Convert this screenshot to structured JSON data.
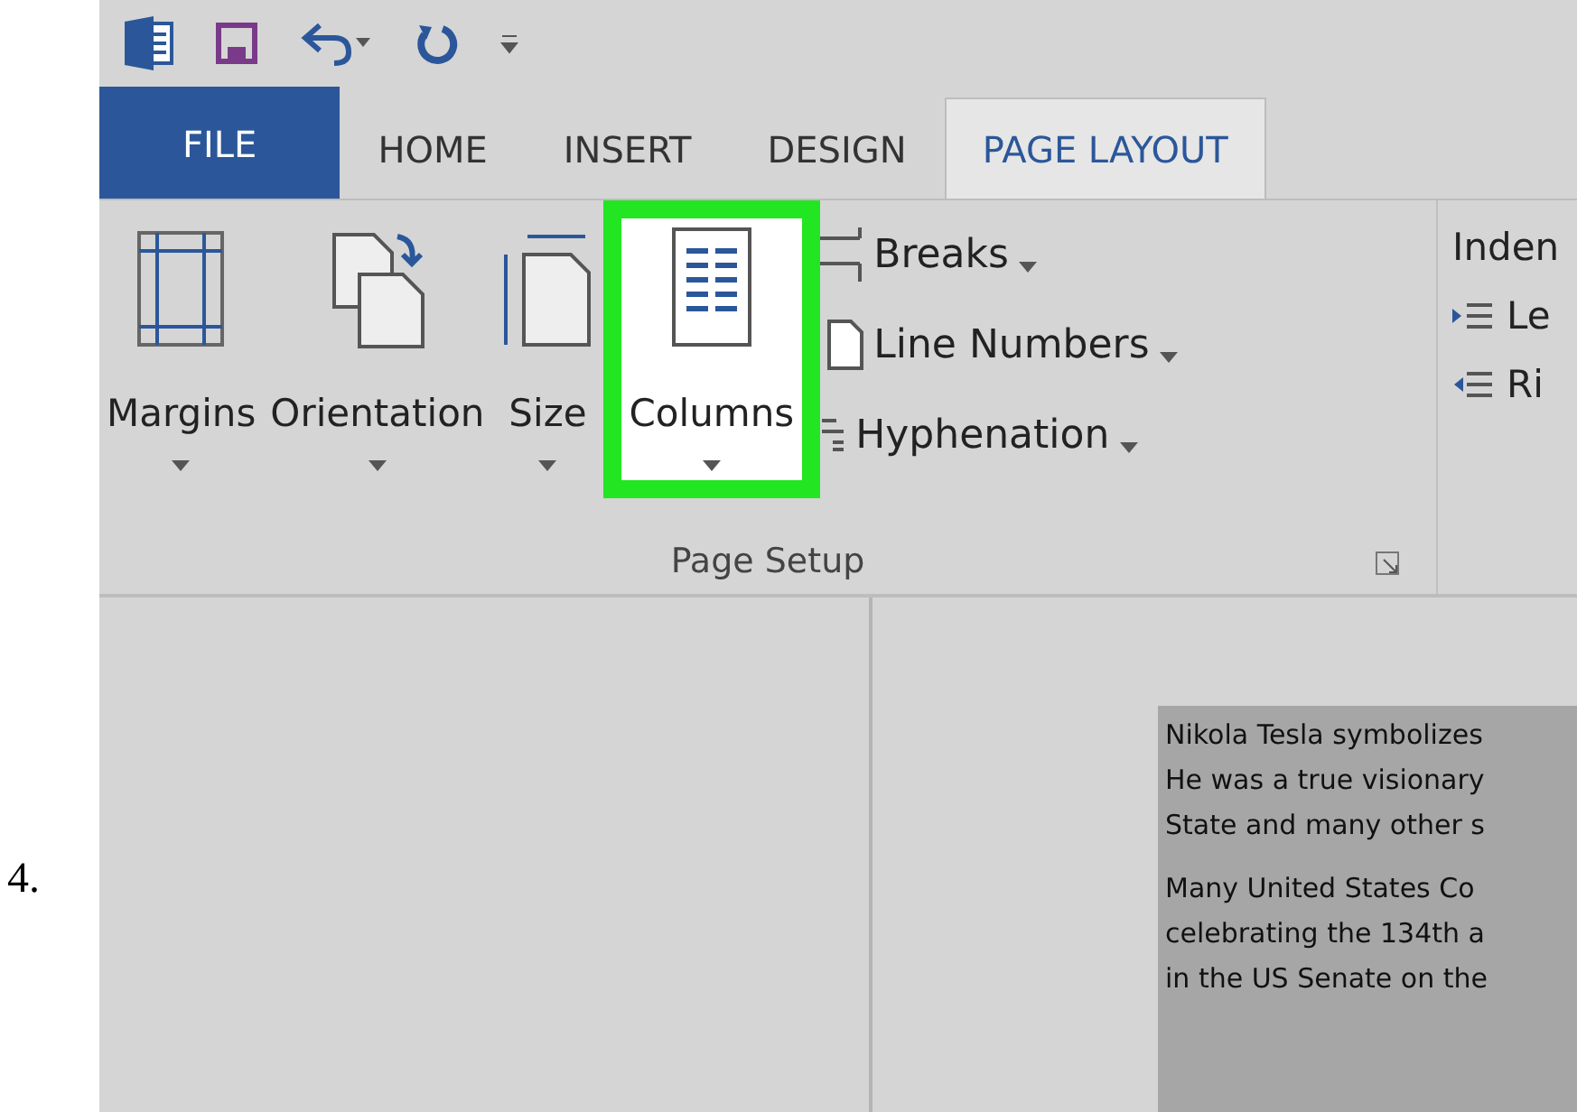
{
  "step_number": "4.",
  "tabs": [
    {
      "label": "FILE",
      "kind": "file",
      "selected": false
    },
    {
      "label": "HOME",
      "kind": "tab",
      "selected": false
    },
    {
      "label": "INSERT",
      "kind": "tab",
      "selected": false
    },
    {
      "label": "DESIGN",
      "kind": "tab",
      "selected": false
    },
    {
      "label": "PAGE LAYOUT",
      "kind": "tab",
      "selected": true
    }
  ],
  "ribbon": {
    "large_buttons": [
      {
        "label": "Margins",
        "kind": "margins",
        "highlighted": false
      },
      {
        "label": "Orientation",
        "kind": "orientation",
        "highlighted": false
      },
      {
        "label": "Size",
        "kind": "size",
        "highlighted": false
      },
      {
        "label": "Columns",
        "kind": "columns",
        "highlighted": true
      }
    ],
    "small_buttons": [
      {
        "label": "Breaks",
        "kind": "breaks"
      },
      {
        "label": "Line Numbers",
        "kind": "line-numbers"
      },
      {
        "label": "Hyphenation",
        "kind": "hyphenation"
      }
    ],
    "group_label": "Page Setup",
    "indent": {
      "title": "Inden",
      "items": [
        "Le",
        "Ri"
      ]
    }
  },
  "document": {
    "highlighted": true,
    "paragraphs": [
      [
        "Nikola Tesla symbolizes",
        "He was a true visionary",
        "State and many other s"
      ],
      [
        "Many United States Co",
        "celebrating the 134th a",
        "in the US Senate on the"
      ]
    ]
  }
}
